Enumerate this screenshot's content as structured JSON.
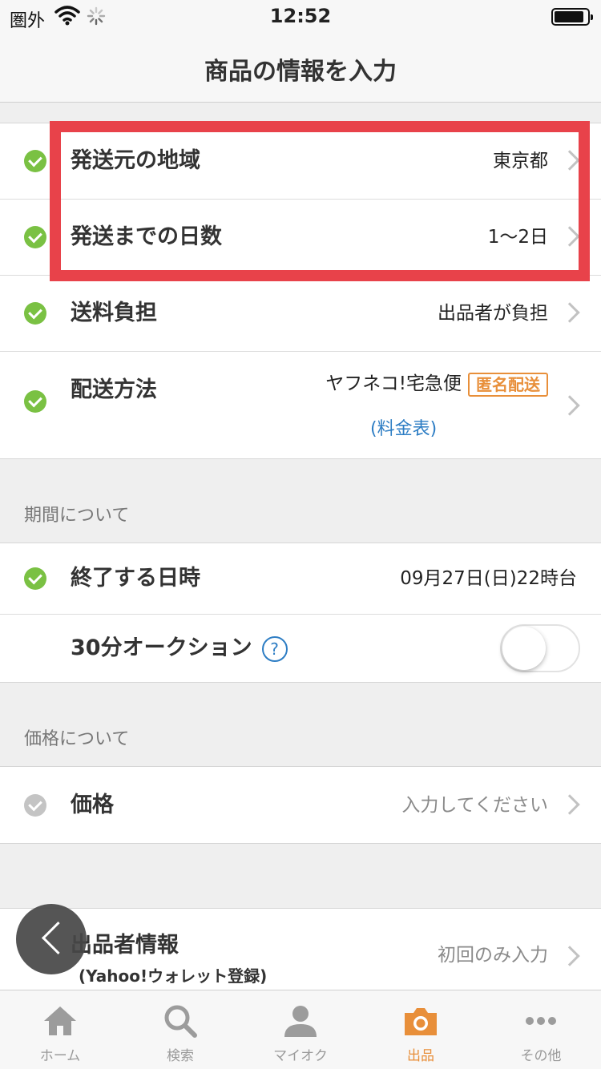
{
  "status_bar": {
    "carrier": "圏外",
    "time": "12:52"
  },
  "nav": {
    "title": "商品の情報を入力"
  },
  "shipping": {
    "origin": {
      "label": "発送元の地域",
      "value": "東京都"
    },
    "days": {
      "label": "発送までの日数",
      "value": "1〜2日"
    },
    "fee": {
      "label": "送料負担",
      "value": "出品者が負担"
    },
    "method": {
      "label": "配送方法",
      "value": "ヤフネコ!宅急便",
      "badge": "匿名配送",
      "link": "(料金表)"
    }
  },
  "period": {
    "section_title": "期間について",
    "end": {
      "label": "終了する日時",
      "value": "09月27日(日)22時台"
    },
    "auction30": {
      "label": "30分オークション",
      "help": "?",
      "enabled": false
    }
  },
  "price": {
    "section_title": "価格について",
    "row": {
      "label": "価格",
      "placeholder": "入力してください"
    }
  },
  "seller": {
    "label": "出品者情報",
    "sublabel": "(Yahoo!ウォレット登録)",
    "value": "初回のみ入力"
  },
  "tabs": [
    {
      "label": "ホーム",
      "icon": "home-icon"
    },
    {
      "label": "検索",
      "icon": "search-icon"
    },
    {
      "label": "マイオク",
      "icon": "person-icon"
    },
    {
      "label": "出品",
      "icon": "camera-icon",
      "active": true
    },
    {
      "label": "その他",
      "icon": "more-icon"
    }
  ],
  "colors": {
    "check_green": "#7ac143",
    "accent_orange": "#e88f3a",
    "highlight_red": "#e8424a",
    "link_blue": "#2d7dc4"
  }
}
